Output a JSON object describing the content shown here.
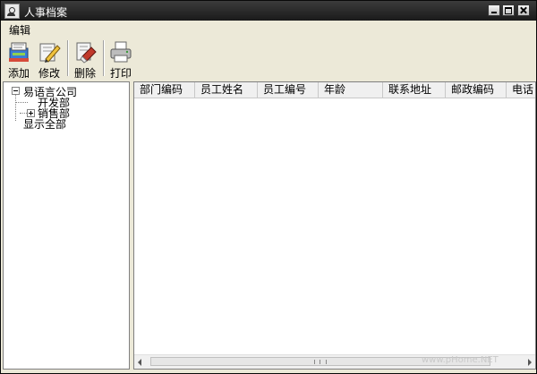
{
  "window": {
    "title": "人事档案"
  },
  "menu": {
    "items": [
      {
        "label": "编辑"
      }
    ]
  },
  "toolbar": {
    "buttons": [
      {
        "label": "添加",
        "icon": "add-record-icon"
      },
      {
        "label": "修改",
        "icon": "edit-pencil-icon"
      },
      {
        "label": "删除",
        "icon": "delete-eraser-icon"
      },
      {
        "label": "打印",
        "icon": "printer-icon"
      }
    ]
  },
  "tree": {
    "root": "易语言公司",
    "children": [
      {
        "label": "开发部",
        "expandable": false
      },
      {
        "label": "销售部",
        "expandable": true
      }
    ],
    "show_all": "显示全部"
  },
  "list": {
    "columns": [
      "部门编码",
      "员工姓名",
      "员工编号",
      "年龄",
      "联系地址",
      "邮政编码",
      "电话"
    ],
    "rows": []
  },
  "watermark": "www.pHome.NET",
  "colors": {
    "titlebar": "#2a2a2a",
    "face": "#ece9d8",
    "panel": "#ffffff"
  }
}
